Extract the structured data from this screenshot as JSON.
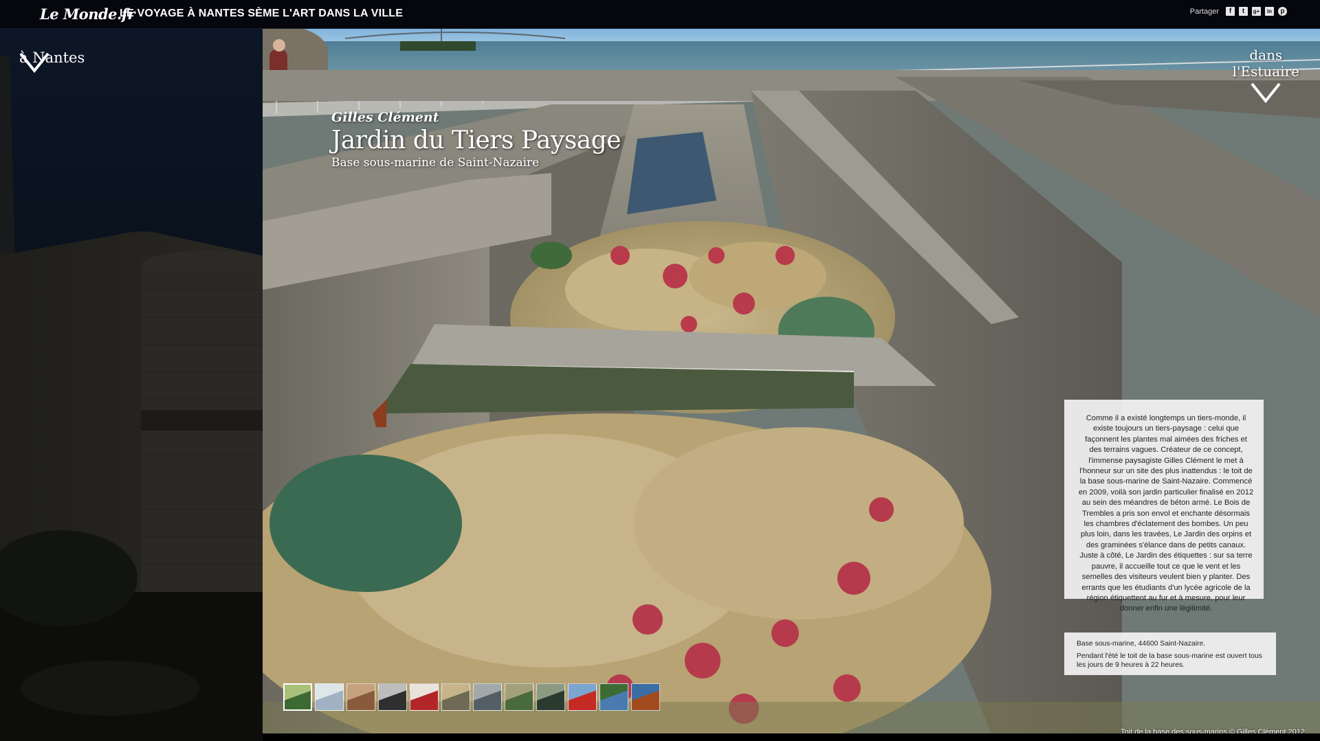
{
  "header": {
    "logo": "Le Monde.fr",
    "headline": "LE VOYAGE À NANTES SÈME L'ART DANS LA VILLE",
    "share_label": "Partager",
    "share_icons": [
      {
        "name": "facebook-icon",
        "glyph": "f"
      },
      {
        "name": "twitter-icon",
        "glyph": "t"
      },
      {
        "name": "google-plus-icon",
        "glyph": "g+"
      },
      {
        "name": "linkedin-icon",
        "glyph": "in"
      },
      {
        "name": "pinterest-icon",
        "glyph": "p"
      }
    ]
  },
  "nav": {
    "left_label": "à Nantes",
    "right_line1": "dans",
    "right_line2": "l'Estuaire"
  },
  "artwork": {
    "author": "Gilles Clément",
    "title": "Jardin du Tiers Paysage",
    "location": "Base sous-marine de Saint-Nazaire"
  },
  "description": "Comme il a existé longtemps un tiers-monde, il existe toujours un tiers-paysage : celui que façonnent les plantes mal aimées des friches et des terrains vagues. Créateur de ce concept, l'immense paysagiste Gilles Clément le met à l'honneur sur un site des plus inattendus : le toit de la base sous-marine de Saint-Nazaire. Commencé en 2009, voilà son jardin particulier finalisé en 2012 au sein des méandres de béton armé. Le Bois de Trembles a pris son envol et enchante désormais les chambres d'éclatement des bombes. Un peu plus loin, dans les travées, Le Jardin des orpins et des graminées s'élance dans de petits canaux. Juste à côté, Le Jardin des étiquettes : sur sa terre pauvre, il accueille tout ce que le vent et les semelles des visiteurs veulent bien y planter. Des errants que les étudiants d'un lycée agricole de la région étiquettent au fur et à mesure, pour leur donner enfin une légitimité.",
  "info": {
    "address": "Base sous-marine, 44600 Saint-Nazaire.",
    "hours": "Pendant l'été le toit de la base sous-marine est ouvert tous les jours de 9 heures à 22 heures."
  },
  "photo_credit": "Toit de la base des sous-marins © Gilles Clément 2012",
  "thumbnails": [
    {
      "active": true,
      "colors": [
        "#3d6a32",
        "#a9c07b"
      ]
    },
    {
      "active": false,
      "colors": [
        "#9fb1c2",
        "#dfe6ea"
      ]
    },
    {
      "active": false,
      "colors": [
        "#8a5a3c",
        "#c7a27f"
      ]
    },
    {
      "active": false,
      "colors": [
        "#2f2f2f",
        "#bdbdbd"
      ]
    },
    {
      "active": false,
      "colors": [
        "#b2262a",
        "#e9e3dd"
      ]
    },
    {
      "active": false,
      "colors": [
        "#6f6a55",
        "#c6b58a"
      ]
    },
    {
      "active": false,
      "colors": [
        "#545e66",
        "#a3a8ab"
      ]
    },
    {
      "active": false,
      "colors": [
        "#496a3a",
        "#a2a07a"
      ]
    },
    {
      "active": false,
      "colors": [
        "#2b3a2e",
        "#8c9a84"
      ]
    },
    {
      "active": false,
      "colors": [
        "#c62a25",
        "#7aa6d0"
      ]
    },
    {
      "active": false,
      "colors": [
        "#4a7bb0",
        "#3c6b33"
      ]
    },
    {
      "active": false,
      "colors": [
        "#a34a1e",
        "#3a6ea5"
      ]
    }
  ]
}
